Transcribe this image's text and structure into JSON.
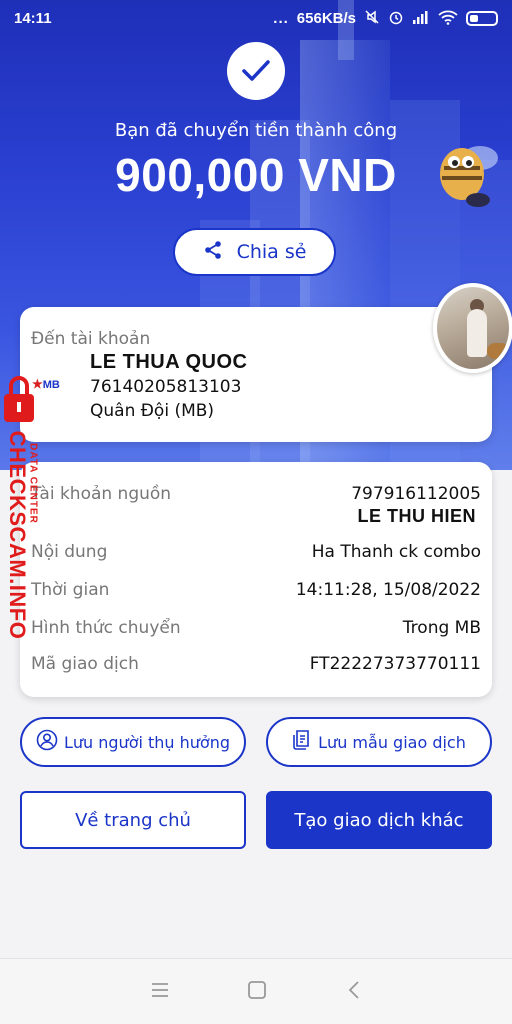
{
  "status_bar": {
    "time": "14:11",
    "dots": "...",
    "network_speed": "656KB/s"
  },
  "header": {
    "success_message": "Bạn đã chuyển tiền thành công",
    "amount": "900,000 VND",
    "share_label": "Chia sẻ"
  },
  "recipient": {
    "label": "Đến tài khoản",
    "name": "LE THUA QUOC",
    "account_number": "76140205813103",
    "bank": "Quân Đội (MB)",
    "bank_logo": "MB"
  },
  "details": {
    "source_label": "Tài khoản nguồn",
    "source_account": "797916112005",
    "source_name": "LE THU HIEN",
    "content_label": "Nội dung",
    "content_value": "Ha Thanh ck combo",
    "time_label": "Thời gian",
    "time_value": "14:11:28, 15/08/2022",
    "method_label": "Hình thức chuyển",
    "method_value": "Trong MB",
    "txn_label": "Mã giao dịch",
    "txn_value": "FT22227373770111"
  },
  "actions": {
    "save_beneficiary": "Lưu người thụ hưởng",
    "save_template": "Lưu mẫu giao dịch",
    "home": "Về trang chủ",
    "new_transaction": "Tạo giao dịch khác"
  },
  "watermark": {
    "brand": "CHECKSCAM.INFO",
    "tagline": "DATA CENTER"
  },
  "colors": {
    "primary": "#1a35c8",
    "watermark": "#e01b1b"
  }
}
